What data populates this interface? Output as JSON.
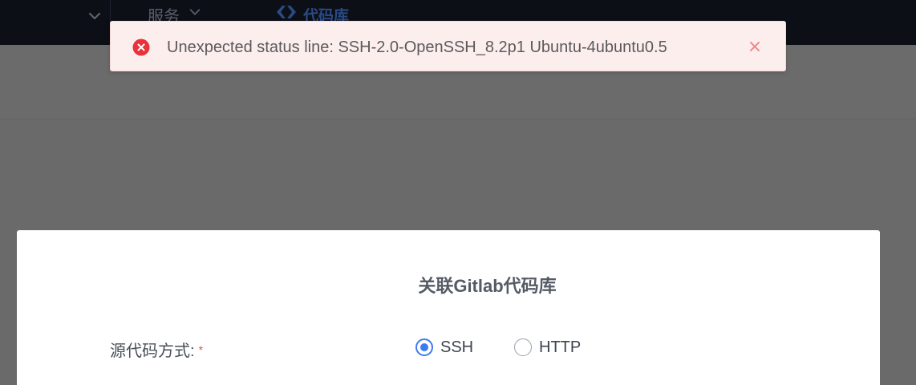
{
  "nav": {
    "services_label": "服务",
    "logo_text": "代码库"
  },
  "toast": {
    "type": "error",
    "message": "Unexpected status line: SSH-2.0-OpenSSH_8.2p1 Ubuntu-4ubuntu0.5",
    "icon": "error-circle-icon",
    "close_icon": "close-icon"
  },
  "modal": {
    "title": "关联Gitlab代码库",
    "form": {
      "source_method_label": "源代码方式:",
      "required_mark": "*",
      "options": [
        {
          "label": "SSH",
          "checked": true
        },
        {
          "label": "HTTP",
          "checked": false
        }
      ]
    }
  },
  "colors": {
    "accent": "#3e7bf2",
    "error": "#e8323c",
    "toast_bg": "#fdeeee",
    "overlay": "#6a6a6a"
  }
}
